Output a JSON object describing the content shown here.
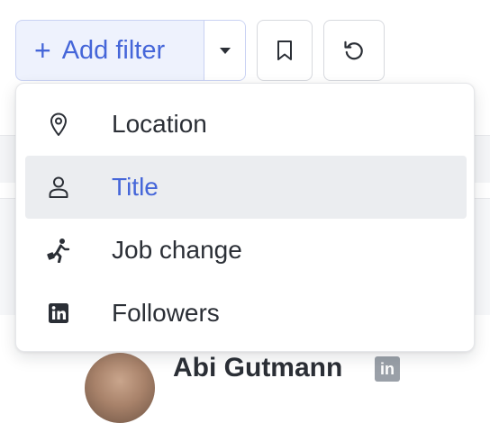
{
  "toolbar": {
    "add_filter_label": "Add filter",
    "add_icon": "plus-icon",
    "dropdown_icon": "caret-down-icon",
    "bookmark_icon": "bookmark-icon",
    "reset_icon": "undo-icon",
    "accent_color": "#4566d9"
  },
  "menu": {
    "items": [
      {
        "label": "Location",
        "icon": "location-pin-icon"
      },
      {
        "label": "Title",
        "icon": "person-icon",
        "highlighted": true
      },
      {
        "label": "Job change",
        "icon": "running-person-icon"
      },
      {
        "label": "Followers",
        "icon": "linkedin-icon"
      }
    ]
  },
  "background": {
    "person_name": "Abi Gutmann",
    "linkedin_badge": "in"
  }
}
